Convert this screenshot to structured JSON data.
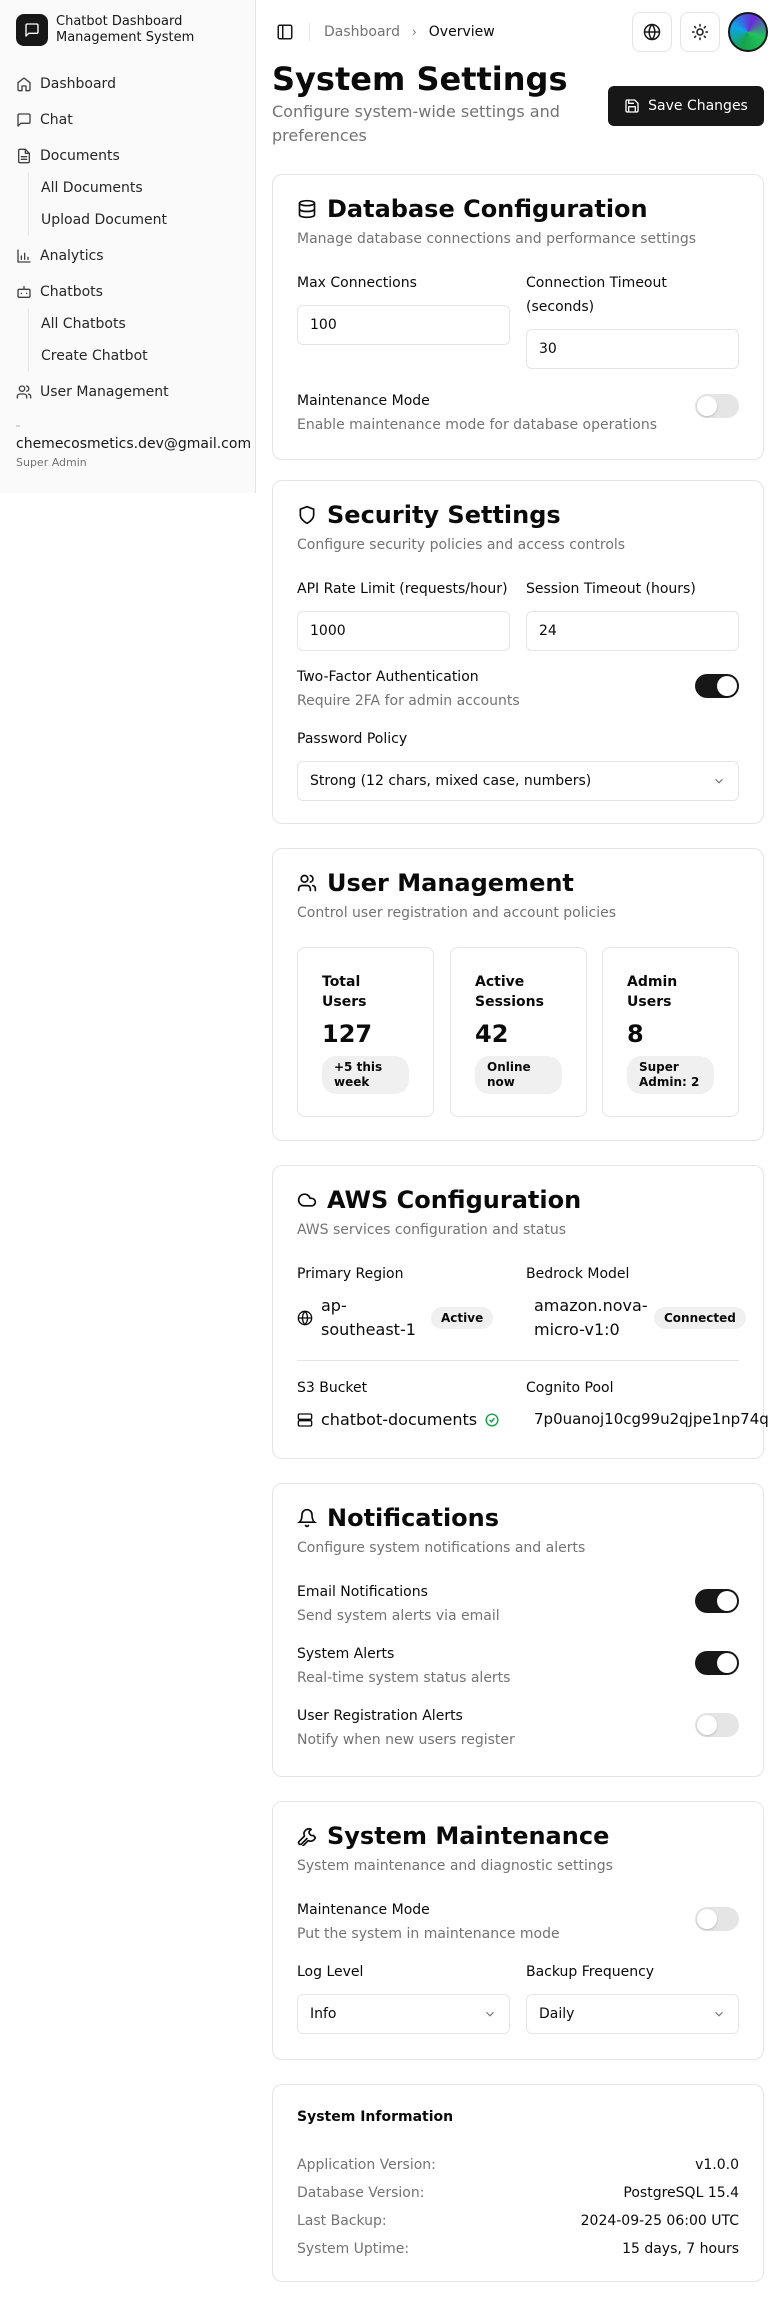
{
  "brand": {
    "line1": "Chatbot Dashboard",
    "line2": "Management System"
  },
  "sidebar": {
    "items": [
      {
        "label": "Dashboard",
        "icon": "home-icon"
      },
      {
        "label": "Chat",
        "icon": "message-icon"
      },
      {
        "label": "Documents",
        "icon": "file-icon"
      },
      {
        "label": "All Documents"
      },
      {
        "label": "Upload Document"
      },
      {
        "label": "Analytics",
        "icon": "bar-chart-icon"
      },
      {
        "label": "Chatbots",
        "icon": "bot-icon"
      },
      {
        "label": "All Chatbots"
      },
      {
        "label": "Create Chatbot"
      },
      {
        "label": "User Management",
        "icon": "users-icon"
      }
    ],
    "user": {
      "email": "chemecosmetics.dev@gmail.com",
      "role": "Super Admin"
    }
  },
  "header": {
    "breadcrumb_parent": "Dashboard",
    "breadcrumb_current": "Overview"
  },
  "page": {
    "title": "System Settings",
    "subtitle": "Configure system-wide settings and preferences",
    "save_label": "Save Changes"
  },
  "database": {
    "title": "Database Configuration",
    "desc": "Manage database connections and performance settings",
    "max_conn_label": "Max Connections",
    "max_conn_value": "100",
    "timeout_label": "Connection Timeout (seconds)",
    "timeout_value": "30",
    "maint_label": "Maintenance Mode",
    "maint_desc": "Enable maintenance mode for database operations",
    "maint_on": false
  },
  "security": {
    "title": "Security Settings",
    "desc": "Configure security policies and access controls",
    "rate_label": "API Rate Limit (requests/hour)",
    "rate_value": "1000",
    "session_label": "Session Timeout (hours)",
    "session_value": "24",
    "twofa_label": "Two-Factor Authentication",
    "twofa_desc": "Require 2FA for admin accounts",
    "twofa_on": true,
    "policy_label": "Password Policy",
    "policy_value": "Strong (12 chars, mixed case, numbers)"
  },
  "users": {
    "title": "User Management",
    "desc": "Control user registration and account policies",
    "stats": [
      {
        "label": "Total Users",
        "value": "127",
        "pill": "+5 this week"
      },
      {
        "label": "Active Sessions",
        "value": "42",
        "pill": "Online now"
      },
      {
        "label": "Admin Users",
        "value": "8",
        "pill": "Super Admin: 2"
      }
    ]
  },
  "aws": {
    "title": "AWS Configuration",
    "desc": "AWS services configuration and status",
    "region_label": "Primary Region",
    "region_value": "ap-southeast-1",
    "region_badge": "Active",
    "model_label": "Bedrock Model",
    "model_value": "amazon.nova-micro-v1:0",
    "model_badge": "Connected",
    "bucket_label": "S3 Bucket",
    "bucket_value": "chatbot-documents",
    "cognito_label": "Cognito Pool",
    "cognito_value": "7p0uanoj10cg99u2qjpe1np74q"
  },
  "notifications": {
    "title": "Notifications",
    "desc": "Configure system notifications and alerts",
    "items": [
      {
        "label": "Email Notifications",
        "desc": "Send system alerts via email",
        "on": true
      },
      {
        "label": "System Alerts",
        "desc": "Real-time system status alerts",
        "on": true
      },
      {
        "label": "User Registration Alerts",
        "desc": "Notify when new users register",
        "on": false
      }
    ]
  },
  "maintenance": {
    "title": "System Maintenance",
    "desc": "System maintenance and diagnostic settings",
    "mode_label": "Maintenance Mode",
    "mode_desc": "Put the system in maintenance mode",
    "mode_on": false,
    "log_label": "Log Level",
    "log_value": "Info",
    "backup_label": "Backup Frequency",
    "backup_value": "Daily"
  },
  "sysinfo": {
    "title": "System Information",
    "rows": [
      {
        "k": "Application Version:",
        "v": "v1.0.0"
      },
      {
        "k": "Database Version:",
        "v": "PostgreSQL 15.4"
      },
      {
        "k": "Last Backup:",
        "v": "2024-09-25 06:00 UTC"
      },
      {
        "k": "System Uptime:",
        "v": "15 days, 7 hours"
      }
    ]
  },
  "colors": {
    "primary": "#171717",
    "muted": "#737373",
    "border": "#e5e5e5",
    "success": "#16a34a"
  }
}
